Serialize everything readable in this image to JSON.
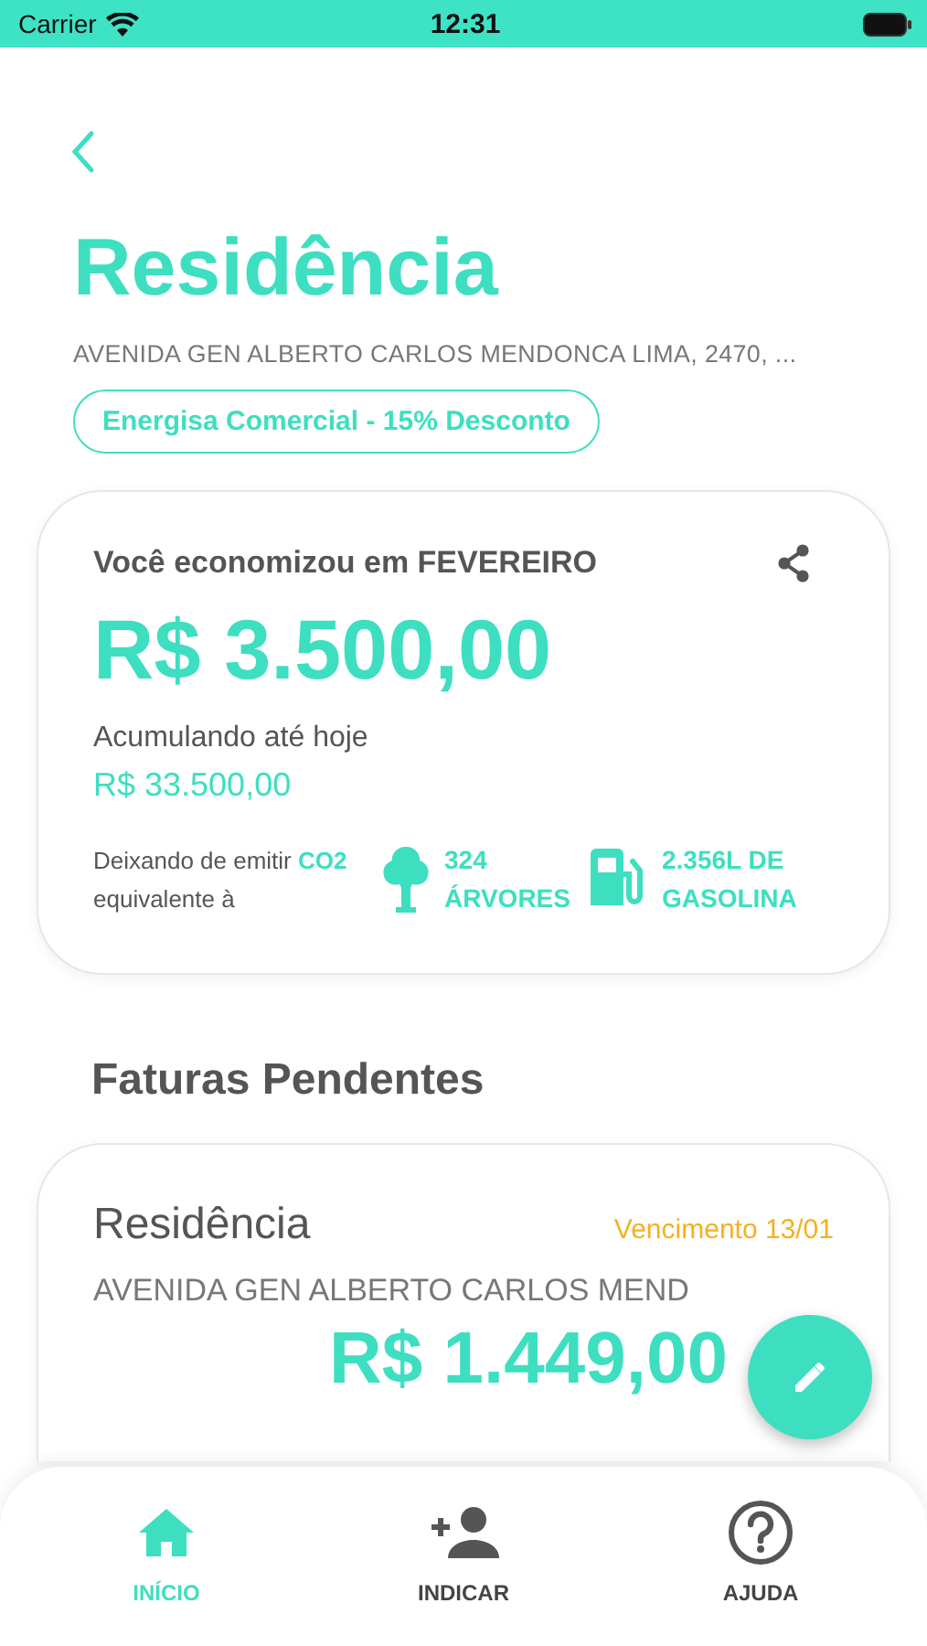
{
  "status_bar": {
    "carrier": "Carrier",
    "time": "12:31"
  },
  "header": {
    "title": "Residência",
    "address": "AVENIDA GEN ALBERTO CARLOS MENDONCA LIMA, 2470, ...",
    "plan": "Energisa Comercial - 15% Desconto"
  },
  "savings_card": {
    "heading": "Você economizou em FEVEREIRO",
    "amount": "R$ 3.500,00",
    "accumulated_label": "Acumulando até hoje",
    "accumulated_amount": "R$ 33.500,00",
    "emission_text": "Deixando de emitir **CO2** equivalente à",
    "equivalents": [
      {
        "kind": "tree",
        "value": "324",
        "unit": "ÁRVORES"
      },
      {
        "kind": "fuel",
        "value": "2.356L DE",
        "unit": "GASOLINA"
      }
    ]
  },
  "pending": {
    "title": "Faturas Pendentes",
    "invoices": [
      {
        "name": "Residência",
        "due": "Vencimento 13/01",
        "address": "AVENIDA GEN ALBERTO CARLOS MEND",
        "amount": "R$ 1.449,00"
      }
    ]
  },
  "tab_bar": [
    {
      "kind": "home",
      "label": "INÍCIO",
      "selected": true
    },
    {
      "kind": "invite",
      "label": "INDICAR",
      "selected": false
    },
    {
      "kind": "help",
      "label": "AJUDA",
      "selected": false
    }
  ]
}
